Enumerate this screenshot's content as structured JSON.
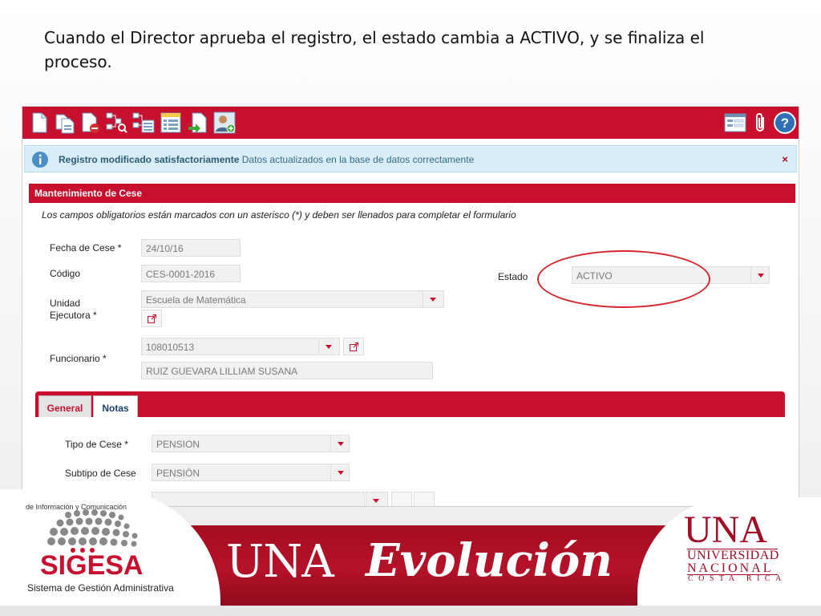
{
  "slide": {
    "caption": "Cuando el Director  aprueba el registro, el estado cambia a ACTIVO, y se finaliza el proceso."
  },
  "toolbar": {
    "left_icons": [
      "new-document-icon",
      "copy-document-icon",
      "delete-document-icon",
      "search-workflow-icon",
      "workflow-list-icon",
      "report-list-icon",
      "export-document-icon",
      "user-add-icon"
    ],
    "right_icons": [
      "form-view-icon",
      "attachment-icon",
      "help-icon"
    ]
  },
  "alert": {
    "title": "Registro modificado satisfactoriamente",
    "message": "Datos actualizados en la base de datos correctamente",
    "close": "×"
  },
  "panel": {
    "title": "Mantenimiento de Cese",
    "instructions": "Los campos obligatorios están marcados con un asterisco (*) y deben ser llenados para completar el formulario"
  },
  "form": {
    "fecha_cese_label": "Fecha de Cese  *",
    "fecha_cese_value": "24/10/16",
    "codigo_label": "Código",
    "codigo_value": "CES-0001-2016",
    "estado_label": "Estado",
    "estado_value": "ACTIVO",
    "unidad_label_1": "Unidad",
    "unidad_label_2": "Ejecutora  *",
    "unidad_value": "Escuela de Matemática",
    "funcionario_label": "Funcionario  *",
    "funcionario_value": "108010513",
    "funcionario_name": "RUIZ  GUEVARA LILLIAM SUSANA"
  },
  "tabs": [
    {
      "label": "General",
      "active": true
    },
    {
      "label": "Notas",
      "active": false
    }
  ],
  "general": {
    "tipo_label": "Tipo de Cese  *",
    "tipo_value": "PENSION",
    "subtipo_label": "Subtipo de Cese",
    "subtipo_value": "PENSIÓN"
  },
  "footer": {
    "cut_text": "de Información y Comunicación",
    "sigesa": "SIGESA",
    "sigesa_sub": "Sistema de Gestión Administrativa",
    "una_text": "UNA",
    "evolucion": "Evolución",
    "logo_una": "UNA",
    "logo_line1": "UNIVERSIDAD",
    "logo_line2": "NACIONAL",
    "logo_line3": "COSTA RICA"
  },
  "colors": {
    "brand_red": "#c8102e",
    "alert_bg": "#d9eef8",
    "field_bg": "#f1f1f1"
  }
}
